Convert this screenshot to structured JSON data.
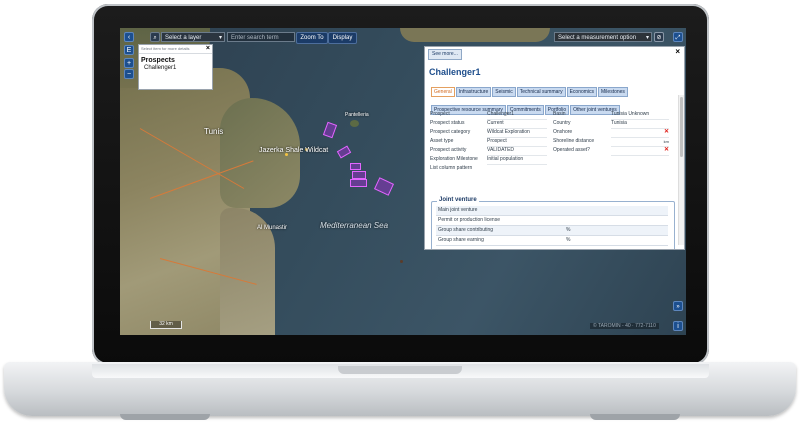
{
  "toolbar": {
    "collapse_icon": "chevron-left-icon",
    "layer_select": "Select a layer",
    "search_placeholder": "Enter search term",
    "zoom_to": "Zoom To",
    "display": "Display",
    "measurement_select": "Select a measurement option",
    "left_buttons": [
      "E",
      "+",
      "−"
    ]
  },
  "prospect_popup": {
    "hint": "Select item for more details",
    "title": "Prospects",
    "items": [
      "Challenger1"
    ]
  },
  "panel": {
    "see_more": "See more...",
    "title": "Challenger1",
    "tabs": [
      "General",
      "Infrastructure",
      "Seismic",
      "Technical summary",
      "Economics",
      "Milestones",
      "Prospective resource summary",
      "Commitments",
      "Portfolio",
      "Other joint ventures"
    ],
    "active_tab": "General",
    "fields_left": [
      {
        "label": "Prospect",
        "value": "Challenger1"
      },
      {
        "label": "Prospect status",
        "value": "Current"
      },
      {
        "label": "Prospect category",
        "value": "Wildcat Exploration"
      },
      {
        "label": "Asset type",
        "value": "Prospect"
      },
      {
        "label": "Prospect activity",
        "value": "VALIDATED"
      },
      {
        "label": "Exploration Milestone",
        "value": "Initial population"
      },
      {
        "label": "List column pattern",
        "value": ""
      }
    ],
    "fields_right": [
      {
        "label": "Basin",
        "value": "Tunisia Unknown"
      },
      {
        "label": "Country",
        "value": "Tunisia"
      },
      {
        "label": "Onshore",
        "value": "✕"
      },
      {
        "label": "Shoreline distance",
        "value": "km"
      },
      {
        "label": "Operated asset?",
        "value": "✕"
      }
    ],
    "joint_venture": {
      "legend": "Joint venture",
      "rows": [
        {
          "label": "Main joint venture",
          "value": ""
        },
        {
          "label": "Permit or production license",
          "value": ""
        },
        {
          "label": "Group share contributing",
          "value": "%"
        },
        {
          "label": "Group share earning",
          "value": "%"
        }
      ]
    }
  },
  "map": {
    "labels": {
      "tunis": "Tunis",
      "pantelleria": "Pantelleria",
      "jazerka": "Jazerka Shale Wildcat",
      "munastir": "Al Munastir",
      "sea": "Mediterranean Sea"
    },
    "scale": "32 km",
    "coords": "© TAROMIN - 40 · 772-7110"
  },
  "colors": {
    "panel_title": "#1e4e8c",
    "tab_active": "#d2691e",
    "prospect_polygon": "#8c32be",
    "close_x": "#e0201a"
  }
}
